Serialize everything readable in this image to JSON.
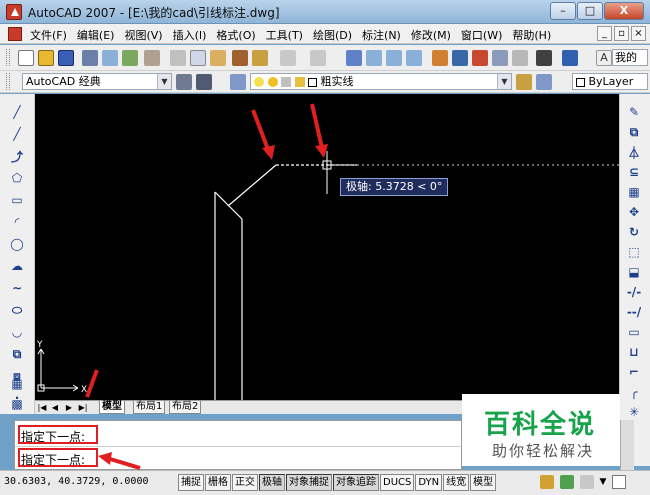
{
  "window": {
    "title": "AutoCAD 2007 - [E:\\我的cad\\引线标注.dwg]",
    "min_label": "–",
    "max_label": "□",
    "close_label": "X"
  },
  "menu": {
    "items": [
      "文件(F)",
      "编辑(E)",
      "视图(V)",
      "插入(I)",
      "格式(O)",
      "工具(T)",
      "绘图(D)",
      "标注(N)",
      "修改(M)",
      "窗口(W)",
      "帮助(H)"
    ],
    "mdi_min": "_",
    "mdi_restore": "▫",
    "mdi_close": "×"
  },
  "toolbar2": {
    "workspace": "AutoCAD 经典",
    "layer": "粗实线",
    "linetype": "ByLayer",
    "search_hint": "我的"
  },
  "canvas": {
    "tooltip": "极轴: 5.3728 < 0°",
    "ucs_x": "X",
    "ucs_y": "Y"
  },
  "tabs": {
    "items": [
      "模型",
      "布局1",
      "布局2"
    ]
  },
  "command": {
    "line1": "指定下一点:",
    "line2": "指定下一点:"
  },
  "watermark": {
    "title": "百科全说",
    "subtitle": "助你轻松解决"
  },
  "status": {
    "coords": "30.6303, 40.3729, 0.0000",
    "buttons": [
      "捕捉",
      "栅格",
      "正交",
      "极轴",
      "对象捕捉",
      "对象追踪",
      "DUCS",
      "DYN",
      "线宽",
      "模型"
    ]
  },
  "colors": {
    "canvas_bg": "#000000",
    "arrow_red": "#e02020",
    "watermark_green": "#17a34a"
  }
}
